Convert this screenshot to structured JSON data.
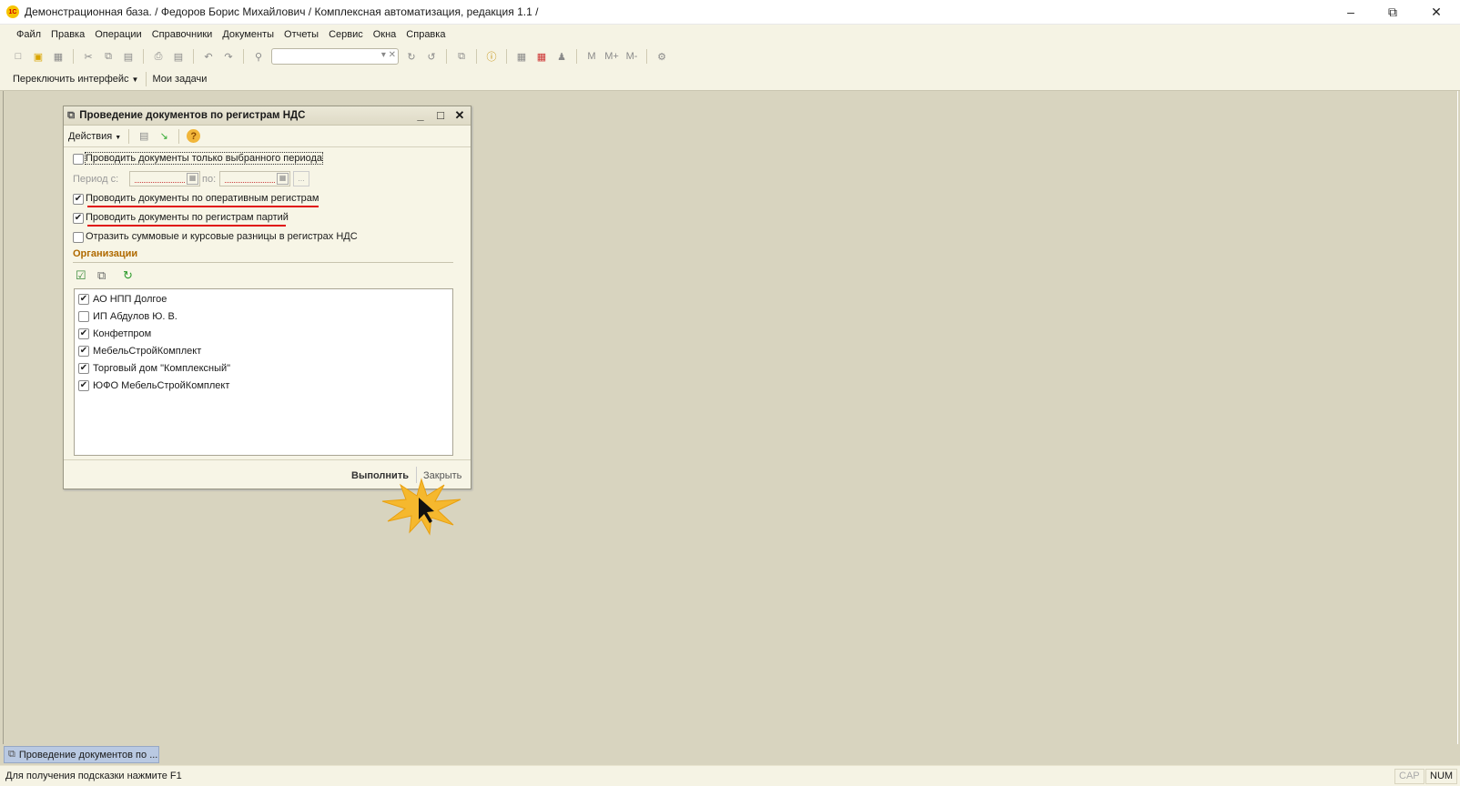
{
  "window": {
    "title": "Демонстрационная база. / Федоров Борис Михайлович /  Комплексная автоматизация, редакция 1.1 /",
    "logo": "1С"
  },
  "menu": [
    "Файл",
    "Правка",
    "Операции",
    "Справочники",
    "Документы",
    "Отчеты",
    "Сервис",
    "Окна",
    "Справка"
  ],
  "toolbar": {
    "memory": [
      "M",
      "M+",
      "M-"
    ]
  },
  "toolbar2": {
    "switch_interface": "Переключить интерфейс",
    "my_tasks": "Мои задачи"
  },
  "dialog": {
    "title": "Проведение документов по регистрам НДС",
    "actions_label": "Действия",
    "options": [
      {
        "label": "Проводить документы только выбранного периода",
        "checked": false
      },
      {
        "label": "Проводить документы по оперативным регистрам",
        "checked": true
      },
      {
        "label": "Проводить документы по регистрам партий",
        "checked": true
      },
      {
        "label": "Отразить суммовые и курсовые разницы в регистрах НДС",
        "checked": false
      }
    ],
    "period_from_label": "Период с:",
    "period_to_label": "по:",
    "date_placeholder": " .  .",
    "ellipsis": "...",
    "orgs_heading": "Организации",
    "organizations": [
      {
        "name": "АО НПП Долгое",
        "checked": true
      },
      {
        "name": "ИП Абдулов Ю. В.",
        "checked": false
      },
      {
        "name": "Конфетпром",
        "checked": true
      },
      {
        "name": "МебельСтройКомплект",
        "checked": true
      },
      {
        "name": "Торговый дом \"Комплексный\"",
        "checked": true
      },
      {
        "name": "ЮФО МебельСтройКомплект",
        "checked": true
      }
    ],
    "execute_label": "Выполнить",
    "close_label": "Закрыть"
  },
  "taskbar": {
    "tab": "Проведение документов по ..."
  },
  "status": {
    "hint": "Для получения подсказки нажмите F1",
    "cap": "CAP",
    "num": "NUM"
  },
  "colors": {
    "accent_heading": "#b06a00",
    "highlight_underline": "#e01010",
    "click_burst": "#f5b82e"
  }
}
